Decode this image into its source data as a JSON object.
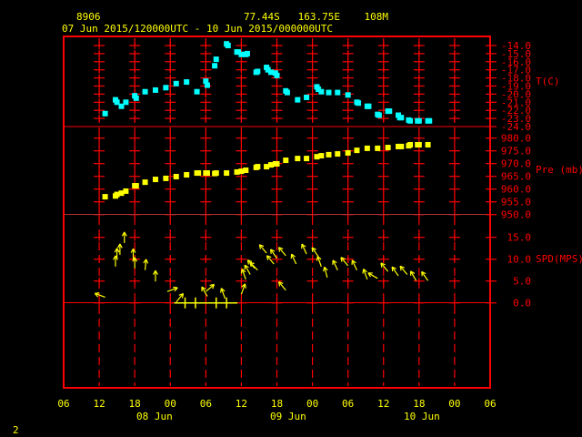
{
  "header": {
    "station_id": "8906",
    "location": "77.44S   163.75E    108M",
    "time_range": "07 Jun 2015/120000UTC - 10 Jun 2015/000000UTC"
  },
  "footer": {
    "frame_number": "2"
  },
  "colors": {
    "frame": "#ff0000",
    "text": "#ffff00",
    "temperature": "#00ffff",
    "pressure": "#ffff00",
    "wind": "#ffff00"
  },
  "chart_data": {
    "type": "scatter",
    "x_axis": {
      "range": [
        "2015-06-07T06:00",
        "2015-06-10T06:00"
      ],
      "tick_labels": [
        "06",
        "12",
        "18",
        "00",
        "06",
        "12",
        "18",
        "00",
        "06",
        "12",
        "18",
        "00",
        "06"
      ],
      "date_labels": [
        "08 Jun",
        "09 Jun",
        "10 Jun"
      ]
    },
    "panels": [
      {
        "ylabel": "T(C)",
        "ylim": [
          -24,
          -14
        ],
        "tick_labels": [
          "-14.0",
          "-15.0",
          "-16.0",
          "-17.0",
          "-18.0",
          "-19.0",
          "-20.0",
          "-21.0",
          "-22.0",
          "-23.0",
          "-24.0"
        ],
        "marker": "square",
        "points": [
          [
            "2015-06-07T13:00",
            -22.4
          ],
          [
            "2015-06-07T14:45",
            -20.7
          ],
          [
            "2015-06-07T15:00",
            -21.0
          ],
          [
            "2015-06-07T15:45",
            -21.5
          ],
          [
            "2015-06-07T16:30",
            -21.0
          ],
          [
            "2015-06-07T18:00",
            -20.2
          ],
          [
            "2015-06-07T18:15",
            -20.5
          ],
          [
            "2015-06-07T19:45",
            -19.7
          ],
          [
            "2015-06-07T21:30",
            -19.5
          ],
          [
            "2015-06-07T23:15",
            -19.2
          ],
          [
            "2015-06-08T01:00",
            -18.7
          ],
          [
            "2015-06-08T02:45",
            -18.5
          ],
          [
            "2015-06-08T04:30",
            -19.7
          ],
          [
            "2015-06-08T06:00",
            -18.4
          ],
          [
            "2015-06-08T06:15",
            -18.9
          ],
          [
            "2015-06-08T07:30",
            -16.5
          ],
          [
            "2015-06-08T07:45",
            -15.7
          ],
          [
            "2015-06-08T09:30",
            -13.8
          ],
          [
            "2015-06-08T09:45",
            -14.0
          ],
          [
            "2015-06-08T11:15",
            -14.8
          ],
          [
            "2015-06-08T11:30",
            -14.8
          ],
          [
            "2015-06-08T12:00",
            -15.1
          ],
          [
            "2015-06-08T12:45",
            -15.1
          ],
          [
            "2015-06-08T13:00",
            -15.0
          ],
          [
            "2015-06-08T14:30",
            -17.3
          ],
          [
            "2015-06-08T14:45",
            -17.2
          ],
          [
            "2015-06-08T16:15",
            -16.7
          ],
          [
            "2015-06-08T16:30",
            -17.0
          ],
          [
            "2015-06-08T17:00",
            -17.3
          ],
          [
            "2015-06-08T17:45",
            -17.4
          ],
          [
            "2015-06-08T18:00",
            -17.7
          ],
          [
            "2015-06-08T19:30",
            -19.6
          ],
          [
            "2015-06-08T19:45",
            -19.8
          ],
          [
            "2015-06-08T21:30",
            -20.7
          ],
          [
            "2015-06-08T23:00",
            -20.4
          ],
          [
            "2015-06-09T00:45",
            -19.1
          ],
          [
            "2015-06-09T01:00",
            -19.4
          ],
          [
            "2015-06-09T01:30",
            -19.7
          ],
          [
            "2015-06-09T02:45",
            -19.8
          ],
          [
            "2015-06-09T04:15",
            -19.8
          ],
          [
            "2015-06-09T06:00",
            -20.1
          ],
          [
            "2015-06-09T07:30",
            -21.0
          ],
          [
            "2015-06-09T07:45",
            -21.1
          ],
          [
            "2015-06-09T09:15",
            -21.5
          ],
          [
            "2015-06-09T09:30",
            -21.5
          ],
          [
            "2015-06-09T11:00",
            -22.5
          ],
          [
            "2015-06-09T11:15",
            -22.6
          ],
          [
            "2015-06-09T12:45",
            -22.1
          ],
          [
            "2015-06-09T13:00",
            -22.1
          ],
          [
            "2015-06-09T14:30",
            -22.6
          ],
          [
            "2015-06-09T14:45",
            -22.9
          ],
          [
            "2015-06-09T15:00",
            -22.9
          ],
          [
            "2015-06-09T16:15",
            -23.2
          ],
          [
            "2015-06-09T16:30",
            -23.3
          ],
          [
            "2015-06-09T17:45",
            -23.3
          ],
          [
            "2015-06-09T18:00",
            -23.3
          ],
          [
            "2015-06-09T19:30",
            -23.3
          ],
          [
            "2015-06-09T19:45",
            -23.3
          ]
        ]
      },
      {
        "ylabel": "Pre (mb)",
        "ylim": [
          950,
          980
        ],
        "tick_labels": [
          "980.0",
          "975.0",
          "970.0",
          "965.0",
          "960.0",
          "955.0",
          "950.0"
        ],
        "marker": "square",
        "points": [
          [
            "2015-06-07T13:00",
            957.0
          ],
          [
            "2015-06-07T14:45",
            957.3
          ],
          [
            "2015-06-07T15:00",
            957.9
          ],
          [
            "2015-06-07T15:45",
            958.4
          ],
          [
            "2015-06-07T16:30",
            959.2
          ],
          [
            "2015-06-07T18:00",
            961.3
          ],
          [
            "2015-06-07T18:15",
            961.3
          ],
          [
            "2015-06-07T19:45",
            962.7
          ],
          [
            "2015-06-07T21:30",
            963.8
          ],
          [
            "2015-06-07T23:15",
            964.2
          ],
          [
            "2015-06-08T01:00",
            964.9
          ],
          [
            "2015-06-08T02:45",
            965.6
          ],
          [
            "2015-06-08T04:30",
            966.3
          ],
          [
            "2015-06-08T04:45",
            966.3
          ],
          [
            "2015-06-08T06:00",
            966.3
          ],
          [
            "2015-06-08T06:15",
            966.3
          ],
          [
            "2015-06-08T07:30",
            966.1
          ],
          [
            "2015-06-08T07:45",
            966.3
          ],
          [
            "2015-06-08T09:30",
            966.3
          ],
          [
            "2015-06-08T11:15",
            966.7
          ],
          [
            "2015-06-08T12:00",
            967.0
          ],
          [
            "2015-06-08T12:45",
            967.4
          ],
          [
            "2015-06-08T14:30",
            968.5
          ],
          [
            "2015-06-08T14:45",
            968.8
          ],
          [
            "2015-06-08T16:15",
            968.8
          ],
          [
            "2015-06-08T17:00",
            969.5
          ],
          [
            "2015-06-08T17:45",
            969.9
          ],
          [
            "2015-06-08T18:00",
            969.9
          ],
          [
            "2015-06-08T19:30",
            971.3
          ],
          [
            "2015-06-08T21:30",
            972.0
          ],
          [
            "2015-06-08T23:00",
            972.0
          ],
          [
            "2015-06-09T00:45",
            972.7
          ],
          [
            "2015-06-09T01:30",
            973.1
          ],
          [
            "2015-06-09T02:45",
            973.5
          ],
          [
            "2015-06-09T04:15",
            973.8
          ],
          [
            "2015-06-09T06:00",
            974.2
          ],
          [
            "2015-06-09T07:30",
            975.2
          ],
          [
            "2015-06-09T09:15",
            976.0
          ],
          [
            "2015-06-09T11:00",
            976.0
          ],
          [
            "2015-06-09T12:45",
            976.3
          ],
          [
            "2015-06-09T14:30",
            976.7
          ],
          [
            "2015-06-09T15:00",
            976.7
          ],
          [
            "2015-06-09T16:15",
            977.0
          ],
          [
            "2015-06-09T16:30",
            977.4
          ],
          [
            "2015-06-09T17:45",
            977.4
          ],
          [
            "2015-06-09T18:00",
            977.4
          ],
          [
            "2015-06-09T19:30",
            977.4
          ]
        ]
      },
      {
        "ylabel": "SPD(MPS)",
        "ylim": [
          0,
          15
        ],
        "tick_labels": [
          "15.0",
          "10.0",
          "5.0",
          "0.0"
        ],
        "marker": "wind-arrow",
        "points_time_speed_direction": [
          [
            "2015-06-07T13:00",
            1.3,
            290
          ],
          [
            "2015-06-07T14:45",
            8.3,
            0
          ],
          [
            "2015-06-07T15:00",
            10.0,
            0
          ],
          [
            "2015-06-07T15:30",
            11.0,
            0
          ],
          [
            "2015-06-07T16:15",
            13.7,
            0
          ],
          [
            "2015-06-07T17:45",
            9.9,
            0
          ],
          [
            "2015-06-07T18:00",
            7.9,
            0
          ],
          [
            "2015-06-07T19:45",
            7.5,
            5
          ],
          [
            "2015-06-07T21:30",
            4.9,
            0
          ],
          [
            "2015-06-07T23:30",
            2.6,
            70
          ],
          [
            "2015-06-08T01:00",
            0.2,
            40
          ],
          [
            "2015-06-08T02:30",
            0,
            null
          ],
          [
            "2015-06-08T04:15",
            0,
            null
          ],
          [
            "2015-06-08T06:00",
            2.6,
            50
          ],
          [
            "2015-06-08T06:15",
            1.5,
            330
          ],
          [
            "2015-06-08T07:45",
            0,
            null
          ],
          [
            "2015-06-08T09:15",
            1.0,
            340
          ],
          [
            "2015-06-08T09:30",
            0,
            null
          ],
          [
            "2015-06-08T12:00",
            2.0,
            20
          ],
          [
            "2015-06-08T12:45",
            5.4,
            340
          ],
          [
            "2015-06-08T13:30",
            6.5,
            330
          ],
          [
            "2015-06-08T14:15",
            7.9,
            320
          ],
          [
            "2015-06-08T14:45",
            7.5,
            315
          ],
          [
            "2015-06-08T16:15",
            11.4,
            320
          ],
          [
            "2015-06-08T17:30",
            8.9,
            320
          ],
          [
            "2015-06-08T18:00",
            10.2,
            325
          ],
          [
            "2015-06-08T19:30",
            10.8,
            320
          ],
          [
            "2015-06-08T19:30",
            2.9,
            320
          ],
          [
            "2015-06-08T21:15",
            8.9,
            335
          ],
          [
            "2015-06-08T23:00",
            11.2,
            335
          ],
          [
            "2015-06-09T01:00",
            10.6,
            325
          ],
          [
            "2015-06-09T01:30",
            8.3,
            340
          ],
          [
            "2015-06-09T02:30",
            5.8,
            345
          ],
          [
            "2015-06-09T04:15",
            7.5,
            335
          ],
          [
            "2015-06-09T06:00",
            8.5,
            320
          ],
          [
            "2015-06-09T07:30",
            7.5,
            335
          ],
          [
            "2015-06-09T09:15",
            5.4,
            340
          ],
          [
            "2015-06-09T11:00",
            5.6,
            300
          ],
          [
            "2015-06-09T12:45",
            7.2,
            320
          ],
          [
            "2015-06-09T14:30",
            6.2,
            325
          ],
          [
            "2015-06-09T16:00",
            6.5,
            320
          ],
          [
            "2015-06-09T17:30",
            5.1,
            330
          ],
          [
            "2015-06-09T19:30",
            5.1,
            325
          ]
        ]
      }
    ],
    "grid": true
  }
}
